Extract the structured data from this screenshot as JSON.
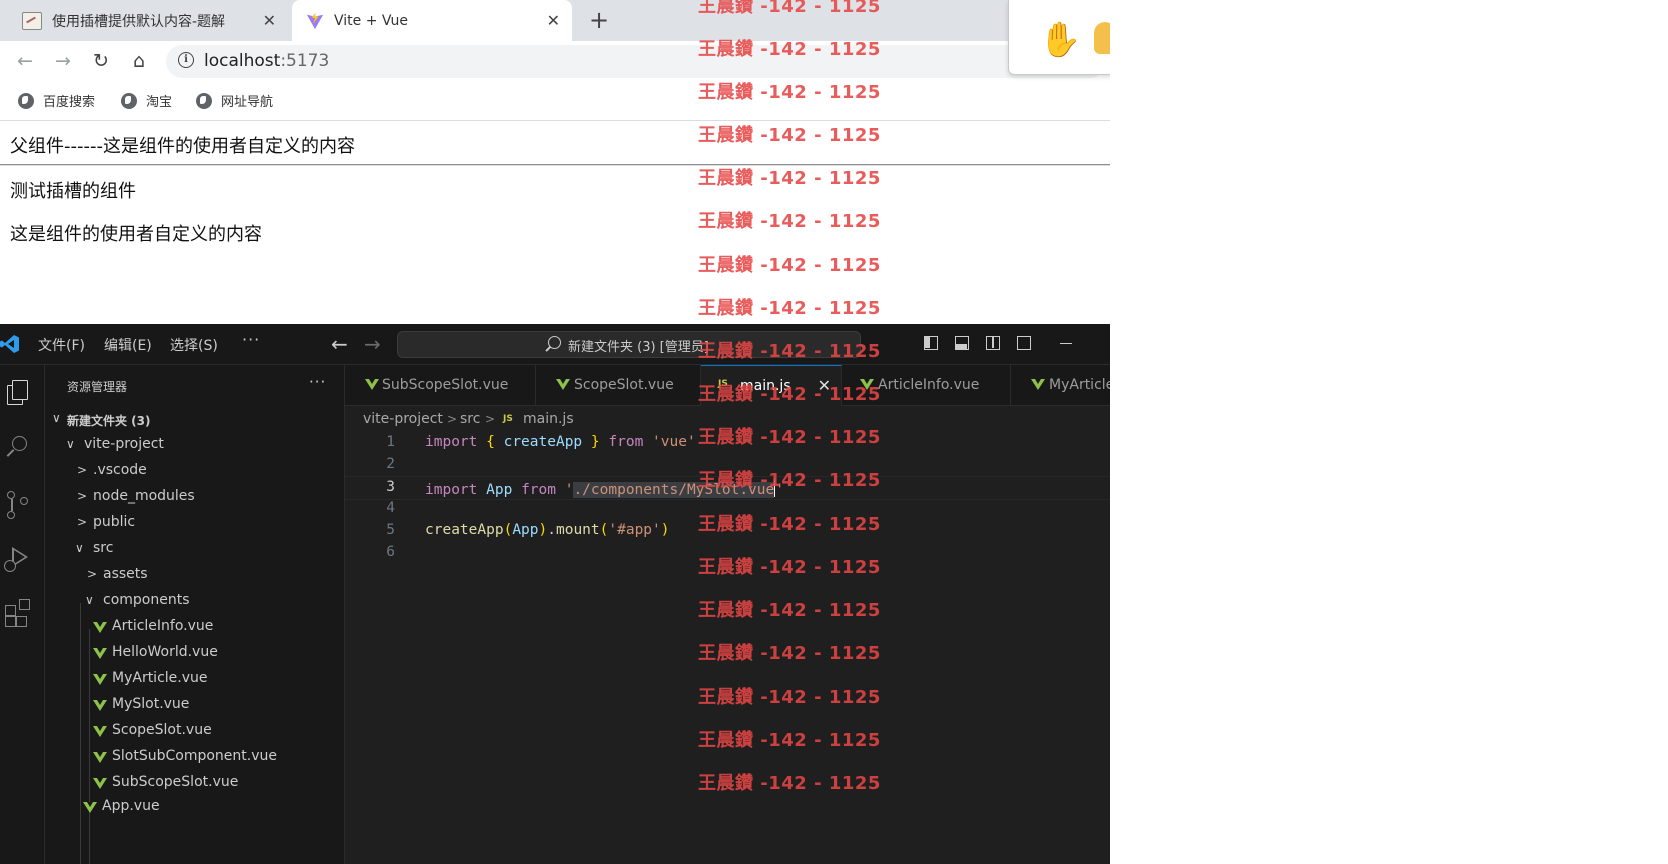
{
  "browser": {
    "tabs": [
      {
        "title": "使用插槽提供默认内容-题解",
        "close": "✕"
      },
      {
        "title": "Vite + Vue",
        "close": "✕",
        "active": true
      }
    ],
    "new_tab": "+",
    "nav": {
      "back": "←",
      "forward": "→",
      "reload": "↻",
      "home": "⌂"
    },
    "url_host": "localhost",
    "url_port": ":5173",
    "info_glyph": "i",
    "bookmarks": [
      "百度搜索",
      "淘宝",
      "网址导航"
    ],
    "extension_popup": {
      "icons": [
        "hand-icon",
        "lightbulb-icon"
      ],
      "hand_glyph": "✋"
    }
  },
  "page": {
    "line1": "父组件------这是组件的使用者自定义的内容",
    "line2": "测试插槽的组件",
    "line3": "这是组件的使用者自定义的内容"
  },
  "vscode": {
    "menu": [
      "文件(F)",
      "编辑(E)",
      "选择(S)",
      "···"
    ],
    "arrows": {
      "back": "←",
      "forward": "→"
    },
    "command_center": "新建文件夹 (3) [管理员]",
    "explorer_title": "资源管理器",
    "explorer_more": "···",
    "tree": [
      {
        "label": "新建文件夹 (3)",
        "chev": "∨"
      },
      {
        "label": "vite-project",
        "chev": "∨"
      },
      {
        "label": ".vscode",
        "chev": ">"
      },
      {
        "label": "node_modules",
        "chev": ">"
      },
      {
        "label": "public",
        "chev": ">"
      },
      {
        "label": "src",
        "chev": "∨"
      },
      {
        "label": "assets",
        "chev": ">"
      },
      {
        "label": "components",
        "chev": "∨"
      },
      {
        "label": "ArticleInfo.vue"
      },
      {
        "label": "HelloWorld.vue"
      },
      {
        "label": "MyArticle.vue"
      },
      {
        "label": "MySlot.vue"
      },
      {
        "label": "ScopeSlot.vue"
      },
      {
        "label": "SlotSubComponent.vue"
      },
      {
        "label": "SubScopeSlot.vue"
      },
      {
        "label": "App.vue"
      }
    ],
    "editor_tabs": [
      {
        "label": "SubScopeSlot.vue"
      },
      {
        "label": "ScopeSlot.vue"
      },
      {
        "label": "main.js",
        "active": true,
        "icon": "JS",
        "close": "✕"
      },
      {
        "label": "ArticleInfo.vue"
      },
      {
        "label": "MyArticleInfo.vue"
      }
    ],
    "breadcrumb": [
      "vite-project",
      "src",
      "main.js"
    ],
    "breadcrumb_sep": ">",
    "breadcrumb_icon": "JS",
    "code": [
      {
        "n": "1",
        "tokens": [
          "import",
          " ",
          "{",
          " ",
          "createApp",
          " ",
          "}",
          " ",
          "from",
          " ",
          "'vue'"
        ]
      },
      {
        "n": "2",
        "tokens": []
      },
      {
        "n": "3",
        "tokens": [
          "import",
          " ",
          "App",
          " ",
          "from",
          " ",
          "'",
          "./components/MySlot.vue",
          "'"
        ]
      },
      {
        "n": "4",
        "tokens": []
      },
      {
        "n": "5",
        "tokens": [
          "createApp",
          "(",
          "App",
          ")",
          ".",
          "mount",
          "(",
          "'#app'",
          ")"
        ]
      },
      {
        "n": "6",
        "tokens": []
      }
    ]
  },
  "watermark": "王晨鑽 -142 - 1125"
}
